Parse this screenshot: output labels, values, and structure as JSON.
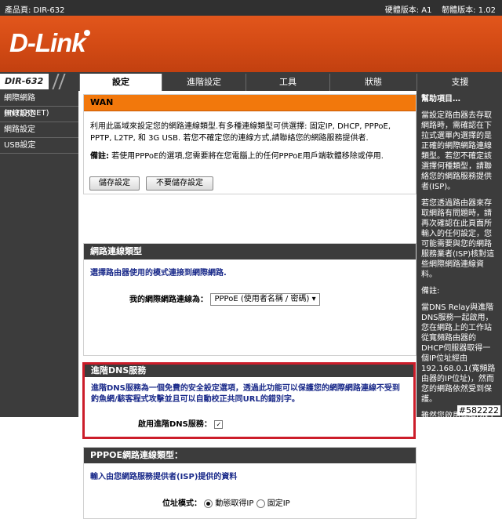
{
  "topbar": {
    "product": "產品頁: DIR-632",
    "versions": "硬體版本: A1    韌體版本: 1.02"
  },
  "brand": {
    "logo": "D-Link"
  },
  "nav": {
    "model": "DIR-632",
    "tabs": [
      "設定",
      "進階設定",
      "工具",
      "狀態",
      "支援"
    ]
  },
  "sidebar": {
    "items": [
      "網際網路(INTERNET)",
      "無線設定",
      "網路設定",
      "USB設定"
    ]
  },
  "wan": {
    "title": "WAN",
    "desc": "利用此區域來設定您的網路連線類型.有多種連線類型可供選擇: 固定IP, DHCP, PPPoE, PPTP, L2TP, 和 3G USB. 若您不確定您的連線方式,請聯絡您的網路服務提供者.",
    "note_label": "備註:",
    "note_text": " 若使用PPPoE的選項,您需要將在您電腦上的任何PPPoE用戶端軟體移除或停用.",
    "save_btn": "儲存設定",
    "nosave_btn": "不要儲存設定"
  },
  "conntype": {
    "title": "網路連線類型",
    "prompt": "選擇路由器使用的模式連接到網際網路.",
    "label": "我的網際網路連線為：",
    "selected": "PPPoE (使用者名稱 / 密碼)"
  },
  "dns": {
    "title": "進階DNS服務",
    "desc": "進階DNS服務為一個免費的安全設定選項，透過此功能可以保護您的網際網路連線不受到釣魚網/駭客程式攻擊並且可以自動校正共同URL的錯別字。",
    "enable_label": "啟用進階DNS服務：",
    "checked_mark": "✓"
  },
  "pppoe": {
    "title": "PPPOE網路連線類型：",
    "prompt": "輸入由您網路服務提供者(ISP)提供的資料",
    "addr_label": "位址模式：",
    "opt_dynamic": "動態取得IP",
    "opt_static": "固定IP"
  },
  "help": {
    "title": "幫助項目…",
    "p1": "當設定路由器去存取網路時，需確認在下拉式選單內選擇的是正確的網際網路連線類型。若您不確定該選擇何種類型，請聯絡您的網路服務提供者(ISP)。",
    "p2": "若您透過路由器來存取網路有問題時，請再次確認在此頁面所輸入的任何設定，您可能需要與您的網路服務業者(ISP)核對這些網際網路連線資料。",
    "p3": "備註:",
    "p4": "當DNS Relay與進階DNS服務一起啟用，您在網路上的工作站從寬頻路由器的DHCP伺服器取得一個IP位址經由192.168.0.1(寬頻路由器的IP位址)，然而您的網路依然受到保護。",
    "p5": "雖然您啟用進階DNS服務功能，您的工作站的DNS IP位址仍然可以修改為您所希望的IP位址，請注意"
  },
  "watermark": "#582222",
  "colors": {
    "accent_orange": "#f2780c",
    "banner": "#d24a14",
    "dark": "#3c3c3c",
    "highlight_red": "#cc1d2a",
    "link_blue": "#1a2a8a"
  }
}
